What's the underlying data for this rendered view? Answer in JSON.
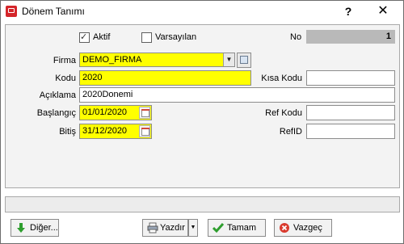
{
  "window": {
    "title": "Dönem Tanımı",
    "help_label": "?",
    "close_label": "✕"
  },
  "form": {
    "aktif": {
      "label": "Aktif",
      "checked": true
    },
    "varsayilan": {
      "label": "Varsayılan",
      "checked": false
    },
    "no": {
      "label": "No",
      "value": "1"
    },
    "firma": {
      "label": "Firma",
      "value": "DEMO_FIRMA"
    },
    "kodu": {
      "label": "Kodu",
      "value": "2020"
    },
    "kisa_kodu": {
      "label": "Kısa Kodu",
      "value": ""
    },
    "aciklama": {
      "label": "Açıklama",
      "value": "2020Donemi"
    },
    "baslangic": {
      "label": "Başlangıç",
      "value": "01/01/2020"
    },
    "ref_kodu": {
      "label": "Ref Kodu",
      "value": ""
    },
    "bitis": {
      "label": "Bitiş",
      "value": "31/12/2020"
    },
    "ref_id": {
      "label": "RefID",
      "value": ""
    }
  },
  "buttons": {
    "diger": "Diğer...",
    "yazdir": "Yazdır",
    "tamam": "Tamam",
    "vazgec": "Vazgeç"
  },
  "colors": {
    "required_field": "#ffff00",
    "app_icon": "#d4252a"
  },
  "icons": {
    "app": "app-logo-icon",
    "dropdown": "chevron-down-icon",
    "lookup": "lookup-list-icon",
    "calendar": "calendar-icon",
    "diger": "green-arrow-down-icon",
    "yazdir": "printer-icon",
    "tamam": "checkmark-icon",
    "vazgec": "cancel-icon"
  }
}
